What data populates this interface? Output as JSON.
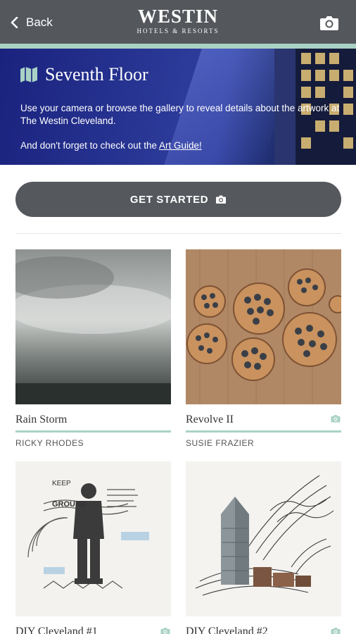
{
  "header": {
    "back_label": "Back",
    "logo_main": "WESTIN",
    "logo_sub": "HOTELS & RESORTS",
    "accent_color": "#a9d2c5",
    "bar_color": "#54575c"
  },
  "hero": {
    "title": "Seventh Floor",
    "description": "Use your camera or browse the gallery to reveal details about the artwork at The Westin Cleveland.",
    "reminder_prefix": "And don't forget to check out the ",
    "reminder_link": "Art Guide!"
  },
  "cta": {
    "label": "GET STARTED"
  },
  "gallery": [
    {
      "title": "Rain Storm",
      "artist": "RICKY RHODES",
      "has_camera_badge": false
    },
    {
      "title": "Revolve II",
      "artist": "SUSIE FRAZIER",
      "has_camera_badge": true
    },
    {
      "title": "DIY Cleveland #1",
      "artist": "",
      "has_camera_badge": true
    },
    {
      "title": "DIY Cleveland #2",
      "artist": "",
      "has_camera_badge": true
    }
  ]
}
